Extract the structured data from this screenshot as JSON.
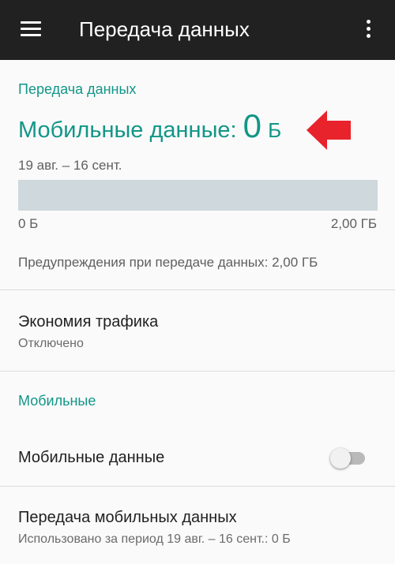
{
  "appbar": {
    "title": "Передача данных",
    "menu_icon": "hamburger-menu-icon",
    "more_icon": "more-vert-icon"
  },
  "usage_section": {
    "header": "Передача данных",
    "usage_label": "Мобильные данные:",
    "usage_value": "0",
    "usage_unit": "Б",
    "period": "19 авг. – 16 сент.",
    "bar_fraction": 0,
    "bar_min_label": "0 Б",
    "bar_max_label": "2,00 ГБ",
    "warning": "Предупреждения при передаче данных: 2,00 ГБ"
  },
  "data_saver": {
    "title": "Экономия трафика",
    "status": "Отключено"
  },
  "mobile_section": {
    "header": "Мобильные",
    "mobile_data_label": "Мобильные данные",
    "mobile_data_enabled": false,
    "usage_title": "Передача мобильных данных",
    "usage_subtitle": "Использовано за период 19 авг. – 16 сент.: 0 Б"
  },
  "colors": {
    "accent": "#129687",
    "appbar": "#212121",
    "arrow": "#e8232b",
    "bar_track": "#cfd8dc"
  }
}
